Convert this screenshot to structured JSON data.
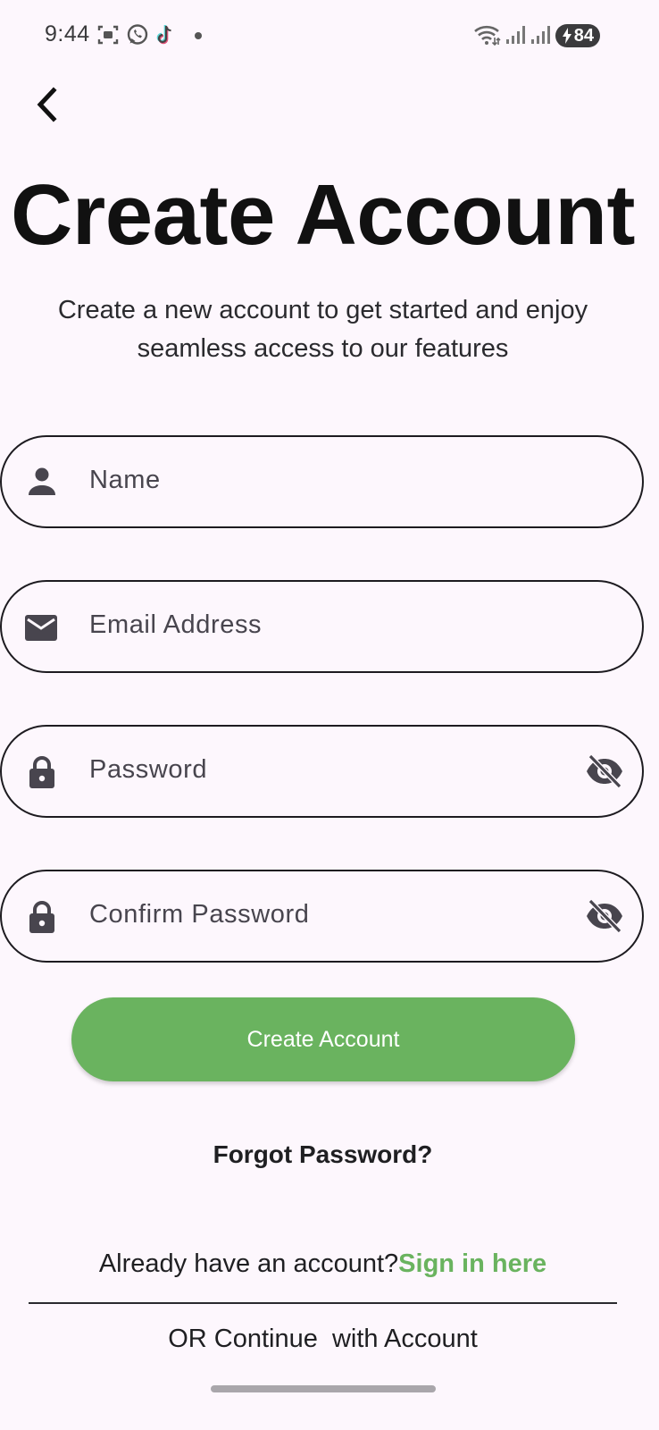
{
  "status_bar": {
    "time": "9:44",
    "battery_level": "84",
    "notification_icons": [
      "screenshot-icon",
      "whatsapp-icon",
      "tiktok-icon"
    ],
    "system_icons": [
      "wifi-icon",
      "signal-icon",
      "signal-icon",
      "battery-charging-icon"
    ]
  },
  "header": {
    "back_icon": "chevron-left-icon"
  },
  "page": {
    "title": "Create Account",
    "subtitle": "Create a new account to get started and enjoy seamless access to our features"
  },
  "form": {
    "name": {
      "placeholder": "Name",
      "icon": "person-icon",
      "value": ""
    },
    "email": {
      "placeholder": "Email Address",
      "icon": "mail-icon",
      "value": ""
    },
    "password": {
      "placeholder": "Password",
      "icon": "lock-icon",
      "toggle_icon": "eye-off-icon",
      "value": ""
    },
    "confirm_password": {
      "placeholder": "Confirm Password",
      "icon": "lock-icon",
      "toggle_icon": "eye-off-icon",
      "value": ""
    },
    "submit_label": "Create Account"
  },
  "links": {
    "forgot_password": "Forgot Password?",
    "already_have_account": "Already have an account?",
    "sign_in": "Sign in here",
    "or_continue": "OR Continue  with Account"
  },
  "colors": {
    "background": "#fdf7fd",
    "accent_green": "#6ab35f",
    "text_dark": "#1b1b1f",
    "field_border": "#1d1b20",
    "icon_gray": "#48454e"
  }
}
